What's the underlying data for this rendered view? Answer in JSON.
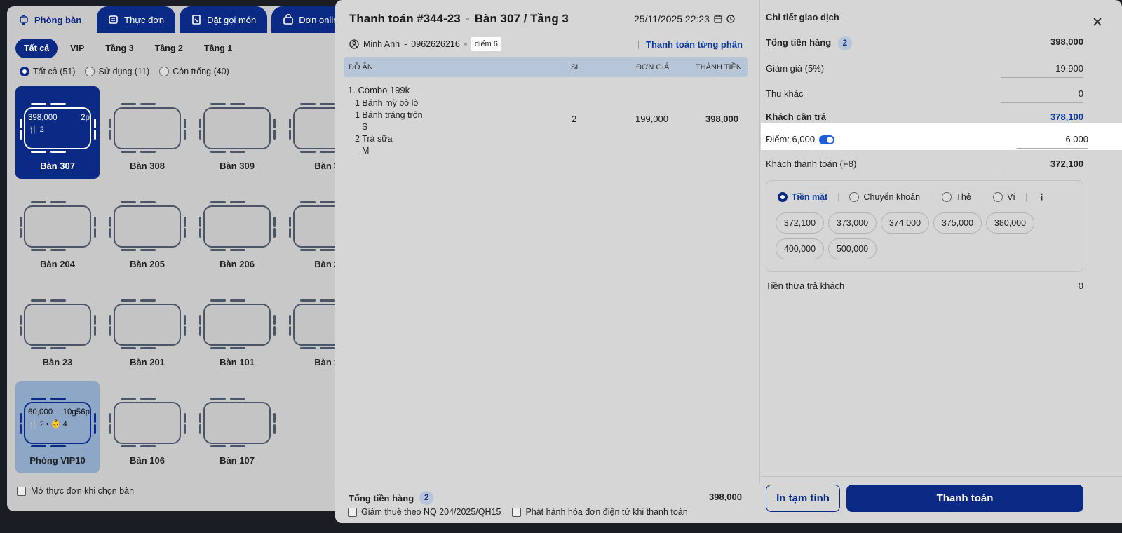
{
  "bg": {
    "top_tabs": [
      {
        "label": "Phòng bàn",
        "icon": "table-icon"
      },
      {
        "label": "Thực đơn",
        "icon": "menu-icon"
      },
      {
        "label": "Đặt gọi món",
        "icon": "order-icon"
      },
      {
        "label": "Đơn online",
        "icon": "bag-icon"
      }
    ],
    "floor_tabs": [
      "Tất cả",
      "VIP",
      "Tầng 3",
      "Tầng 2",
      "Tầng 1"
    ],
    "filters": [
      "Tất cả (51)",
      "Sử dụng (11)",
      "Còn trống (40)"
    ],
    "tables": [
      {
        "name": "Bàn 307",
        "amount": "398,000",
        "duration": "2p",
        "guests": "2",
        "state": "active"
      },
      {
        "name": "Bàn 308"
      },
      {
        "name": "Bàn 309"
      },
      {
        "name": "Bàn 3"
      },
      {
        "name": "Bàn 204"
      },
      {
        "name": "Bàn 205"
      },
      {
        "name": "Bàn 206"
      },
      {
        "name": "Bàn 2"
      },
      {
        "name": "Bàn 23"
      },
      {
        "name": "Bàn 201"
      },
      {
        "name": "Bàn 101"
      },
      {
        "name": "Bàn 1"
      },
      {
        "name": "Phòng VIP10",
        "amount": "60,000",
        "duration": "10g56p",
        "guests": "2",
        "kids": "4",
        "state": "vip"
      },
      {
        "name": "Bàn 106"
      },
      {
        "name": "Bàn 107"
      }
    ],
    "footer_check": "Mở thực đơn khi chọn bàn"
  },
  "payment": {
    "title": "Thanh toán #344-23",
    "table": "Bàn 307 / Tầng 3",
    "datetime": "25/11/2025 22:23",
    "customer_name": "Minh Anh",
    "customer_sep": "-",
    "customer_phone": "0962626216",
    "points_badge": "điểm 6",
    "partial_link": "Thanh toán từng phần",
    "columns": {
      "item": "ĐỒ ĂN",
      "qty": "SL",
      "price": "ĐƠN GIÁ",
      "total": "THÀNH TIỀN"
    },
    "item": {
      "name": "1. Combo 199k",
      "lines": [
        {
          "text": "1 Bánh mỳ bỏ lò",
          "level": "sub"
        },
        {
          "text": "1 Bánh tráng trộn",
          "level": "sub"
        },
        {
          "text": "S",
          "level": "opt"
        },
        {
          "text": "2 Trà sữa",
          "level": "sub"
        },
        {
          "text": "M",
          "level": "opt"
        }
      ],
      "qty": "2",
      "price": "199,000",
      "total": "398,000"
    },
    "footer": {
      "total_label": "Tổng tiền hàng",
      "total_count": "2",
      "total_amount": "398,000",
      "check_tax": "Giảm thuế theo NQ 204/2025/QH15",
      "check_invoice": "Phát hành hóa đơn điện tử khi thanh toán"
    }
  },
  "detail": {
    "title": "Chi tiết giao dịch",
    "subtotal_label": "Tổng tiền hàng",
    "subtotal_count": "2",
    "subtotal": "398,000",
    "discount_label": "Giảm giá (5%)",
    "discount": "19,900",
    "other_label": "Thu khác",
    "other": "0",
    "due_label": "Khách cần trả",
    "due": "378,100",
    "points_label": "Điểm: 6,000",
    "points_value": "6,000",
    "paid_label": "Khách thanh toán (F8)",
    "paid": "372,100",
    "methods": [
      "Tiền mặt",
      "Chuyển khoản",
      "Thẻ",
      "Ví"
    ],
    "amounts": [
      "372,100",
      "373,000",
      "374,000",
      "375,000",
      "380,000",
      "400,000",
      "500,000"
    ],
    "change_label": "Tiền thừa trả khách",
    "change": "0",
    "print_label": "In tạm tính",
    "pay_label": "Thanh toán"
  },
  "colors": {
    "primary": "#0a2a86",
    "accent": "#1a5fd9",
    "link": "#0a3a9e"
  }
}
